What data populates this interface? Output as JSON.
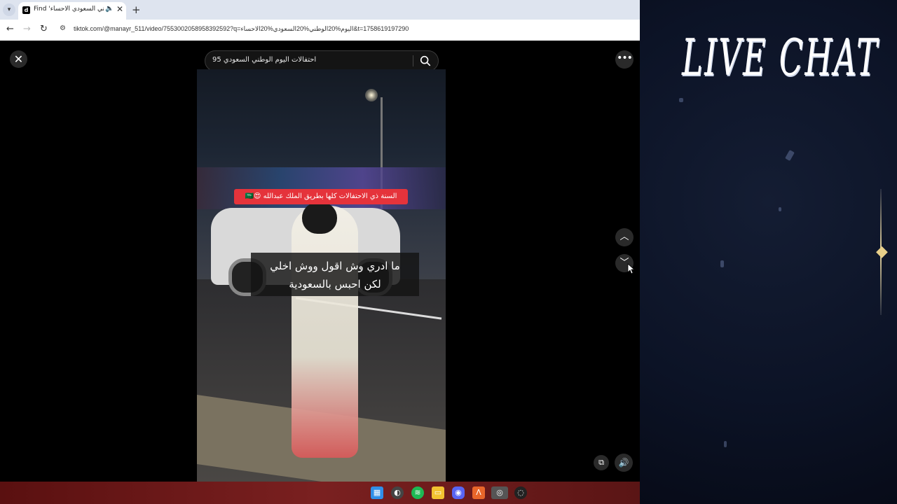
{
  "browser": {
    "tab": {
      "favicon_letter": "d",
      "title": "Find 'اليوم الوطني السعودي الاحساء'",
      "audio_icon": "speaker-icon",
      "close_glyph": "✕"
    },
    "new_tab_glyph": "+",
    "url": "tiktok.com/@manayr_511/video/7553002058958392592?q=اليوم%20الوطني%20السعودي%20الاحساء&t=1758619197290"
  },
  "tiktok": {
    "search_query": "احتفالات اليوم الوطني السعودي 95",
    "video": {
      "banner_text": "السنة ذي الاحتفالات كلها بطريق الملك عبدالله 😍🇸🇦",
      "caption_line1": "ما ادري وش اقول ووش اخلي",
      "caption_line2": "لكن احبس بالسعودية"
    }
  },
  "taskbar": {
    "icons": [
      "windows-start-icon",
      "app-icon",
      "spotify-icon",
      "file-explorer-icon",
      "discord-icon",
      "app-icon",
      "chrome-icon",
      "obs-icon"
    ]
  },
  "chat_panel": {
    "title": "LIVE CHAT"
  },
  "colors": {
    "banner_red": "#e5333b",
    "chat_bg": "#0c1326",
    "taskbar": "#7a2020"
  }
}
